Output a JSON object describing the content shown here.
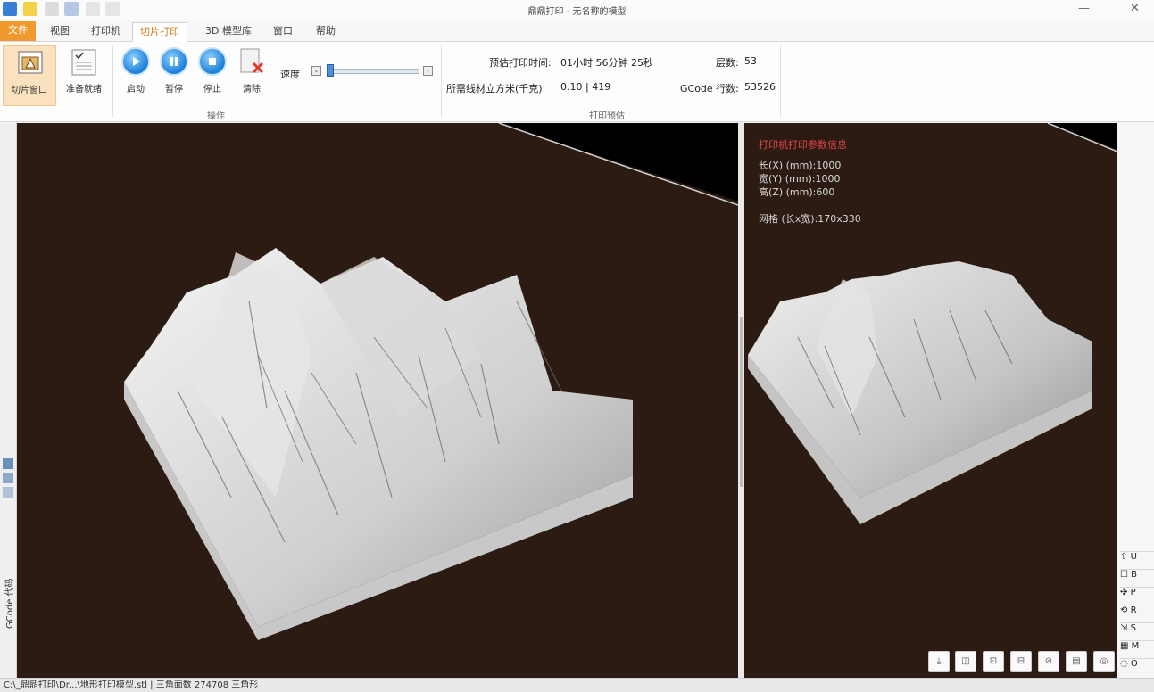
{
  "window": {
    "title": "鼎鼎打印 - 无名称的模型",
    "min_glyph": "—",
    "close_glyph": "✕"
  },
  "tabs": [
    {
      "label": "文件"
    },
    {
      "label": "视图"
    },
    {
      "label": "打印机"
    },
    {
      "label": "切片打印"
    },
    {
      "label": "3D 模型库"
    },
    {
      "label": "窗口"
    },
    {
      "label": "帮助"
    }
  ],
  "ribbon": {
    "buttons": {
      "slice_window": "切片窗口",
      "prepare": "准备就绪",
      "start": "启动",
      "pause": "暂停",
      "stop": "停止",
      "kill": "清除"
    },
    "speed_label": "速度",
    "group_print": "操作",
    "group_info": "打印预估",
    "print_time_label": "预估打印时间:",
    "print_time_value": "01小时 56分钟 25秒",
    "layers_label": "层数:",
    "layers_value": "53",
    "filament_label": "所需线材立方米(千克):",
    "filament_value": "0.10 | 419",
    "gcode_label": "GCode 行数:",
    "gcode_value": "53526"
  },
  "viewport_right": {
    "heading": "打印机打印参数信息",
    "x_line": "长(X) (mm):1000",
    "y_line": "宽(Y) (mm):1000",
    "z_line": "高(Z) (mm):600",
    "grid_line": "网格 (长x宽):170x330"
  },
  "view_buttons": [
    "⤓",
    "◫",
    "⊡",
    "⊟",
    "⊘",
    "▤",
    "◎"
  ],
  "right_strip": [
    {
      "icon": "⇧",
      "label": "U"
    },
    {
      "icon": "☐",
      "label": "B"
    },
    {
      "icon": "✣",
      "label": "P"
    },
    {
      "icon": "⟲",
      "label": "R"
    },
    {
      "icon": "⇲",
      "label": "S"
    },
    {
      "icon": "▦",
      "label": "M"
    },
    {
      "icon": "◌",
      "label": "O"
    }
  ],
  "left_strip": {
    "gcode_tab": "GCode 代码"
  },
  "status_bar": {
    "text": "C:\\_鼎鼎打印\\Dr...\\地形打印模型.stl | 三角面数 274708 三角形"
  },
  "colors": {
    "accent": "#f09a2e",
    "viewport_bg": "#2b1b13",
    "overlay_heading": "#e04545"
  }
}
